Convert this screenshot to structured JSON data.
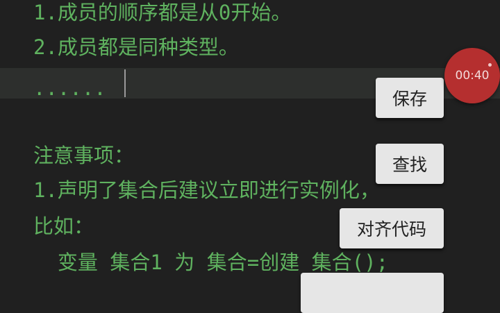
{
  "editor": {
    "lines": [
      "1.成员的顺序都是从0开始。",
      "2.成员都是同种类型。",
      "......",
      "",
      "注意事项：",
      "1.声明了集合后建议立即进行实例化，",
      "比如：",
      "  变量 集合1 为 集合=创建 集合();"
    ]
  },
  "buttons": {
    "save": "保存",
    "find": "查找",
    "align": "对齐代码",
    "partial": ""
  },
  "recorder": {
    "time": "00:40"
  },
  "colors": {
    "background": "#202020",
    "code_text": "#5fb25f",
    "current_line": "#2d2f2d",
    "button_bg": "#e6e6e6",
    "timer_bg": "#b52f2f"
  }
}
